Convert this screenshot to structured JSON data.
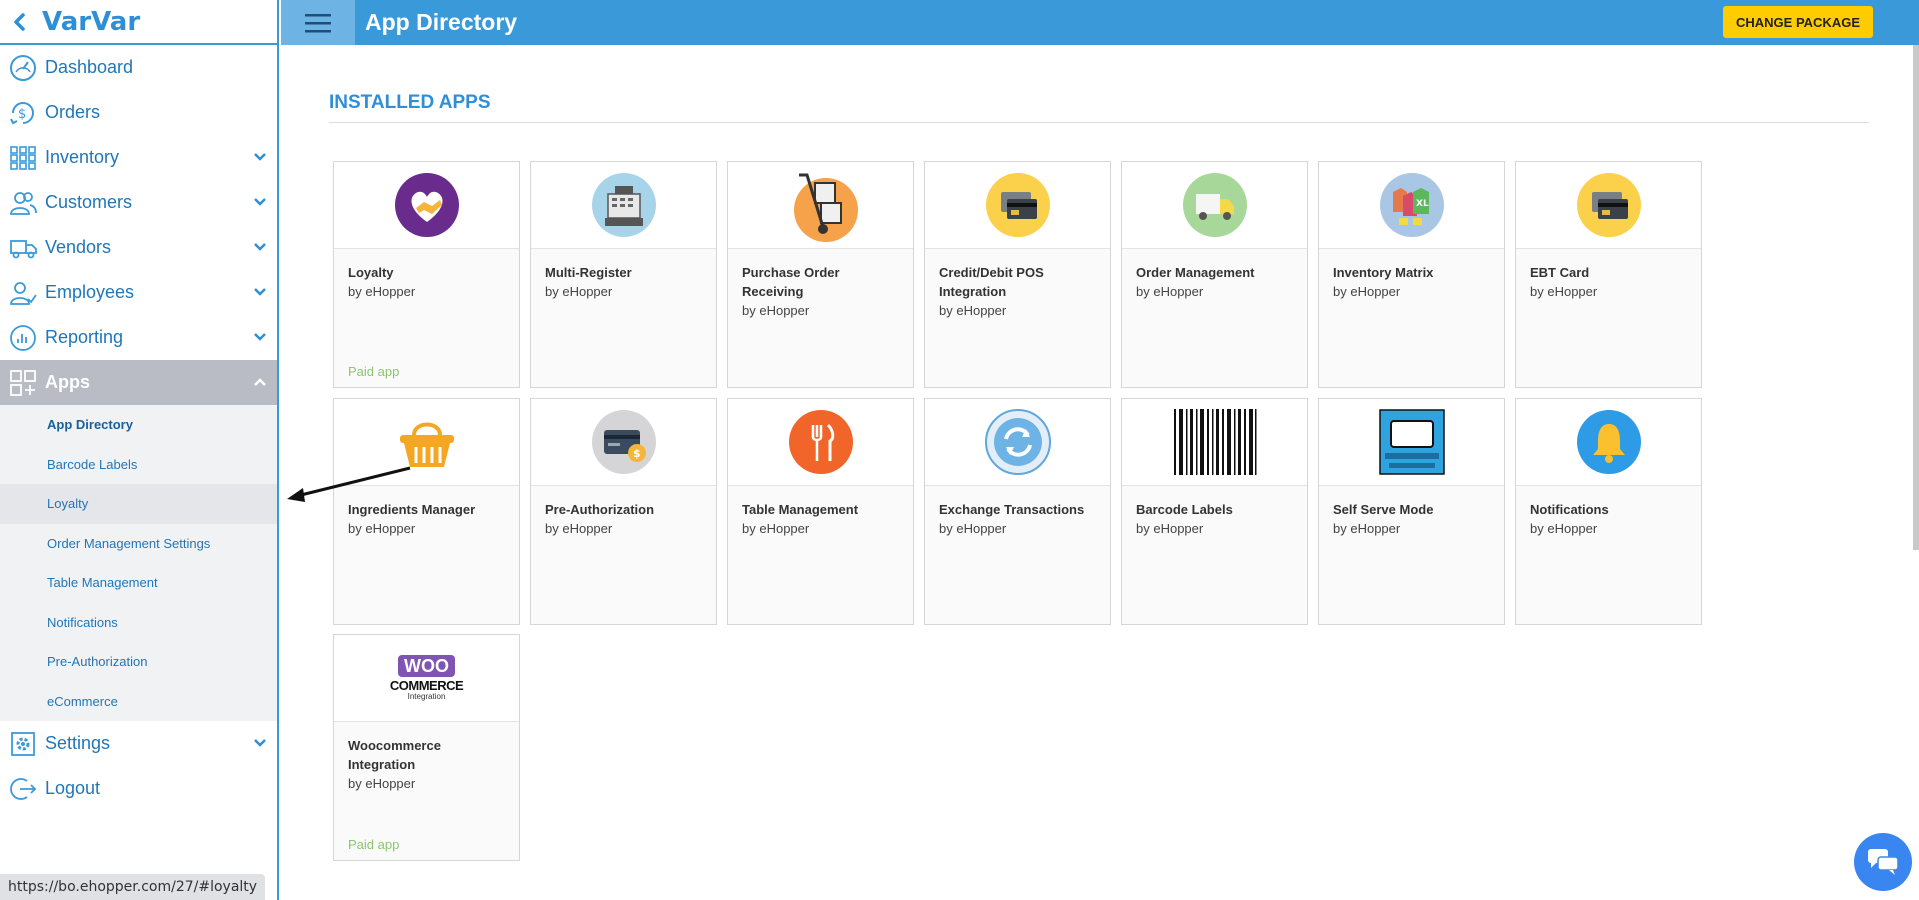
{
  "sidebar": {
    "brand": "VarVar",
    "items": [
      {
        "label": "Dashboard",
        "icon": "dashboard-icon",
        "chevron": false
      },
      {
        "label": "Orders",
        "icon": "orders-icon",
        "chevron": false
      },
      {
        "label": "Inventory",
        "icon": "inventory-icon",
        "chevron": true
      },
      {
        "label": "Customers",
        "icon": "customers-icon",
        "chevron": true
      },
      {
        "label": "Vendors",
        "icon": "vendors-icon",
        "chevron": true
      },
      {
        "label": "Employees",
        "icon": "employees-icon",
        "chevron": true
      },
      {
        "label": "Reporting",
        "icon": "reporting-icon",
        "chevron": true
      },
      {
        "label": "Apps",
        "icon": "apps-icon",
        "chevron": true,
        "expanded": true
      },
      {
        "label": "Settings",
        "icon": "settings-icon",
        "chevron": true
      },
      {
        "label": "Logout",
        "icon": "logout-icon",
        "chevron": false
      }
    ],
    "apps_submenu": [
      "App Directory",
      "Barcode Labels",
      "Loyalty",
      "Order Management Settings",
      "Table Management",
      "Notifications",
      "Pre-Authorization",
      "eCommerce"
    ]
  },
  "header": {
    "title": "App Directory",
    "change_package": "CHANGE PACKAGE"
  },
  "main": {
    "section_title": "INSTALLED APPS",
    "apps": [
      {
        "title": "Loyalty",
        "by": "by eHopper",
        "paid": "Paid app",
        "icon": "loyalty-handshake-icon"
      },
      {
        "title": "Multi-Register",
        "by": "by eHopper",
        "paid": "",
        "icon": "cash-register-icon"
      },
      {
        "title": "Purchase Order Receiving",
        "by": "by eHopper",
        "paid": "",
        "icon": "hand-truck-icon"
      },
      {
        "title": "Credit/Debit POS Integration",
        "by": "by eHopper",
        "paid": "",
        "icon": "credit-cards-icon"
      },
      {
        "title": "Order Management",
        "by": "by eHopper",
        "paid": "",
        "icon": "delivery-truck-icon"
      },
      {
        "title": "Inventory Matrix",
        "by": "by eHopper",
        "paid": "",
        "icon": "clothing-matrix-icon"
      },
      {
        "title": "EBT Card",
        "by": "by eHopper",
        "paid": "",
        "icon": "ebt-cards-icon"
      },
      {
        "title": "Ingredients Manager",
        "by": "by eHopper",
        "paid": "",
        "icon": "basket-icon"
      },
      {
        "title": "Pre-Authorization",
        "by": "by eHopper",
        "paid": "",
        "icon": "card-coin-icon"
      },
      {
        "title": "Table Management",
        "by": "by eHopper",
        "paid": "",
        "icon": "fork-knife-icon"
      },
      {
        "title": "Exchange Transactions",
        "by": "by eHopper",
        "paid": "",
        "icon": "exchange-arrows-icon"
      },
      {
        "title": "Barcode Labels",
        "by": "by eHopper",
        "paid": "",
        "icon": "barcode-icon"
      },
      {
        "title": "Self Serve Mode",
        "by": "by eHopper",
        "paid": "",
        "icon": "kiosk-screen-icon"
      },
      {
        "title": "Notifications",
        "by": "by eHopper",
        "paid": "",
        "icon": "bell-icon"
      },
      {
        "title": "Woocommerce Integration",
        "by": "by eHopper",
        "paid": "Paid app",
        "icon": "woocommerce-logo-icon",
        "logo_text": "WOO",
        "logo_sub": "COMMERCE",
        "logo_small": "Integration"
      }
    ]
  },
  "status_bar": {
    "url": "https://bo.ehopper.com/27/#loyalty"
  },
  "colors": {
    "primary": "#3a9ad9",
    "accent": "#ffcc00",
    "paid": "#8cc66e"
  }
}
